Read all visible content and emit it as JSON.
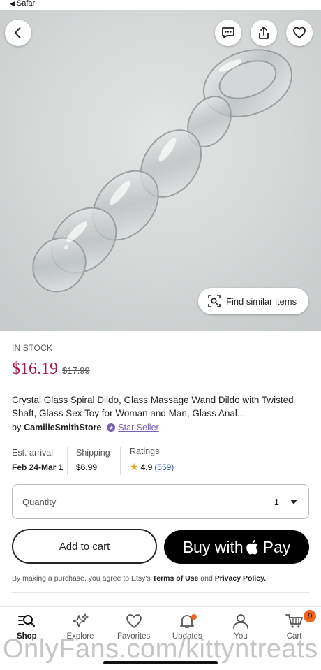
{
  "status_bar": {
    "back_app": "Safari"
  },
  "hero": {
    "find_similar_label": "Find similar items"
  },
  "product": {
    "stock_status": "IN STOCK",
    "price": "$16.19",
    "original_price": "$17.99",
    "title": "Crystal Glass Spiral Dildo, Glass Massage Wand Dildo with Twisted Shaft, Glass Sex Toy for Woman and Man, Glass Anal...",
    "by_label": "by",
    "seller": "CamilleSmithStore",
    "seller_badge": "Star Seller"
  },
  "details": {
    "arrival_label": "Est. arrival",
    "arrival_value": "Feb 24-Mar 1",
    "shipping_label": "Shipping",
    "shipping_value": "$6.99",
    "ratings_label": "Ratings",
    "rating_value": "4.9",
    "rating_count": "(559)"
  },
  "quantity": {
    "label": "Quantity",
    "value": "1"
  },
  "actions": {
    "add_to_cart": "Add to cart",
    "buy_with": "Buy with",
    "pay": "Pay"
  },
  "legal": {
    "prefix": "By making a purchase, you agree to Etsy's",
    "terms": "Terms of Use",
    "and": "and",
    "privacy": "Privacy Policy."
  },
  "tabs": [
    {
      "label": "Shop",
      "icon": "shop-search-icon"
    },
    {
      "label": "Explore",
      "icon": "sparkle-icon"
    },
    {
      "label": "Favorites",
      "icon": "heart-icon"
    },
    {
      "label": "Updates",
      "icon": "bell-icon"
    },
    {
      "label": "You",
      "icon": "person-icon"
    },
    {
      "label": "Cart",
      "icon": "cart-icon",
      "badge": "9"
    }
  ],
  "watermark": "OnlyFans.com/kittyntreats",
  "colors": {
    "price": "#a61a4a",
    "accent": "#f1641e",
    "star_seller": "#7a5fb5"
  }
}
